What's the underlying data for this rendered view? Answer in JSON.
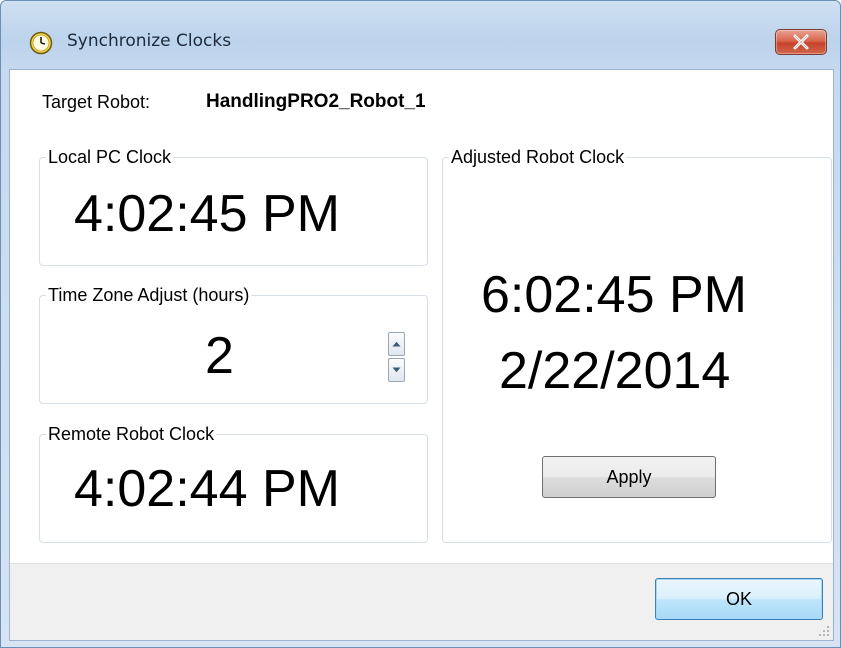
{
  "window": {
    "title": "Synchronize Clocks",
    "icon": "clock-icon",
    "close_icon": "close-icon"
  },
  "target": {
    "label": "Target Robot:",
    "value": "HandlingPRO2_Robot_1"
  },
  "local_clock": {
    "title": "Local PC Clock",
    "time": "4:02:45 PM"
  },
  "timezone": {
    "title": "Time Zone Adjust (hours)",
    "value": "2"
  },
  "remote_clock": {
    "title": "Remote Robot Clock",
    "time": "4:02:44 PM"
  },
  "adjusted_clock": {
    "title": "Adjusted Robot Clock",
    "time": "6:02:45 PM",
    "date": "2/22/2014",
    "apply_label": "Apply"
  },
  "footer": {
    "ok_label": "OK"
  },
  "colors": {
    "close_button": "#c5432c",
    "frame": "#bcd3ec",
    "ok_border": "#3c7fb1"
  }
}
